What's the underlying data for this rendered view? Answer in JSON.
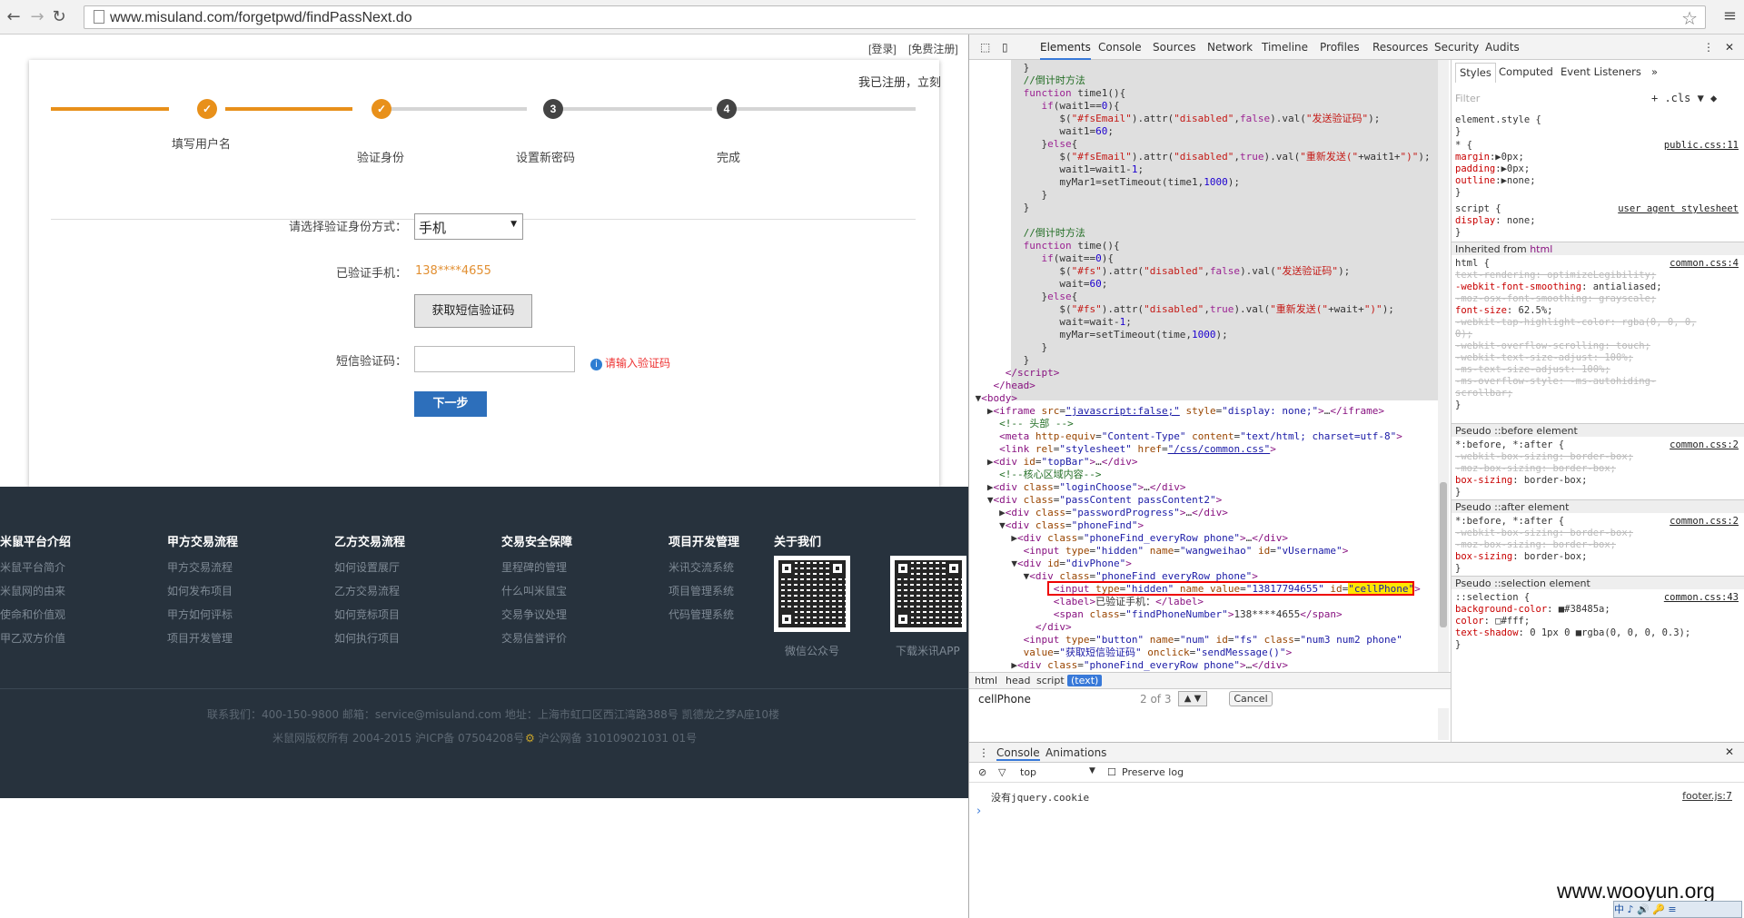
{
  "browser": {
    "url": "www.misuland.com/forgetpwd/findPassNext.do"
  },
  "site": {
    "topbar": {
      "login": "[登录]",
      "register": "[免费注册]",
      "already": "我已注册，立刻"
    },
    "steps": [
      {
        "n": "✓",
        "label": "填写用户名",
        "done": true
      },
      {
        "n": "✓",
        "label": "验证身份",
        "done": true
      },
      {
        "n": "3",
        "label": "设置新密码",
        "done": false
      },
      {
        "n": "4",
        "label": "完成",
        "done": false
      }
    ],
    "form": {
      "method_label": "请选择验证身份方式：",
      "method_value": "手机",
      "verified_label": "已验证手机：",
      "verified_value": "138****4655",
      "sms_button": "获取短信验证码",
      "code_label": "短信验证码：",
      "code_hint": "请输入验证码",
      "next_button": "下一步"
    },
    "footer": {
      "cols": [
        {
          "title": "米鼠平台介绍",
          "links": [
            "米鼠平台简介",
            "米鼠网的由来",
            "使命和价值观",
            "甲乙双方价值"
          ]
        },
        {
          "title": "甲方交易流程",
          "links": [
            "甲方交易流程",
            "如何发布项目",
            "甲方如何评标",
            "项目开发管理"
          ]
        },
        {
          "title": "乙方交易流程",
          "links": [
            "如何设置展厅",
            "乙方交易流程",
            "如何竞标项目",
            "如何执行项目"
          ]
        },
        {
          "title": "交易安全保障",
          "links": [
            "里程碑的管理",
            "什么叫米鼠宝",
            "交易争议处理",
            "交易信誉评价"
          ]
        },
        {
          "title": "项目开发管理",
          "links": [
            "米讯交流系统",
            "项目管理系统",
            "代码管理系统"
          ]
        },
        {
          "title": "关于我们",
          "links": []
        }
      ],
      "qr1_caption": "微信公众号",
      "qr2_caption": "下载米讯APP",
      "contact": "联系我们：400-150-9800 邮箱：service@misuland.com 地址：上海市虹口区西江湾路388号 凯德龙之梦A座10楼",
      "copyright": "米鼠网版权所有 2004-2015 沪ICP备 07504208号",
      "police": "沪公网备 310109021031 01号"
    }
  },
  "devtools": {
    "tabs": [
      "Elements",
      "Console",
      "Sources",
      "Network",
      "Timeline",
      "Profiles",
      "Resources",
      "Security",
      "Audits"
    ],
    "crumbs": [
      "html",
      "head",
      "script",
      "(text)"
    ],
    "search_query": "cellPhone",
    "search_count": "2 of 3",
    "cancel": "Cancel",
    "styles_tabs": [
      "Styles",
      "Computed",
      "Event Listeners"
    ],
    "filter": "Filter",
    "console_tabs": [
      "Console",
      "Animations"
    ],
    "console_context": "top",
    "preserve_log": "Preserve log",
    "console_msg": "没有jquery.cookie",
    "console_src": "footer.js:7"
  },
  "watermark": "www.wooyun.org",
  "tray_text": "中 ♪ 🔊 🔑 ≡"
}
